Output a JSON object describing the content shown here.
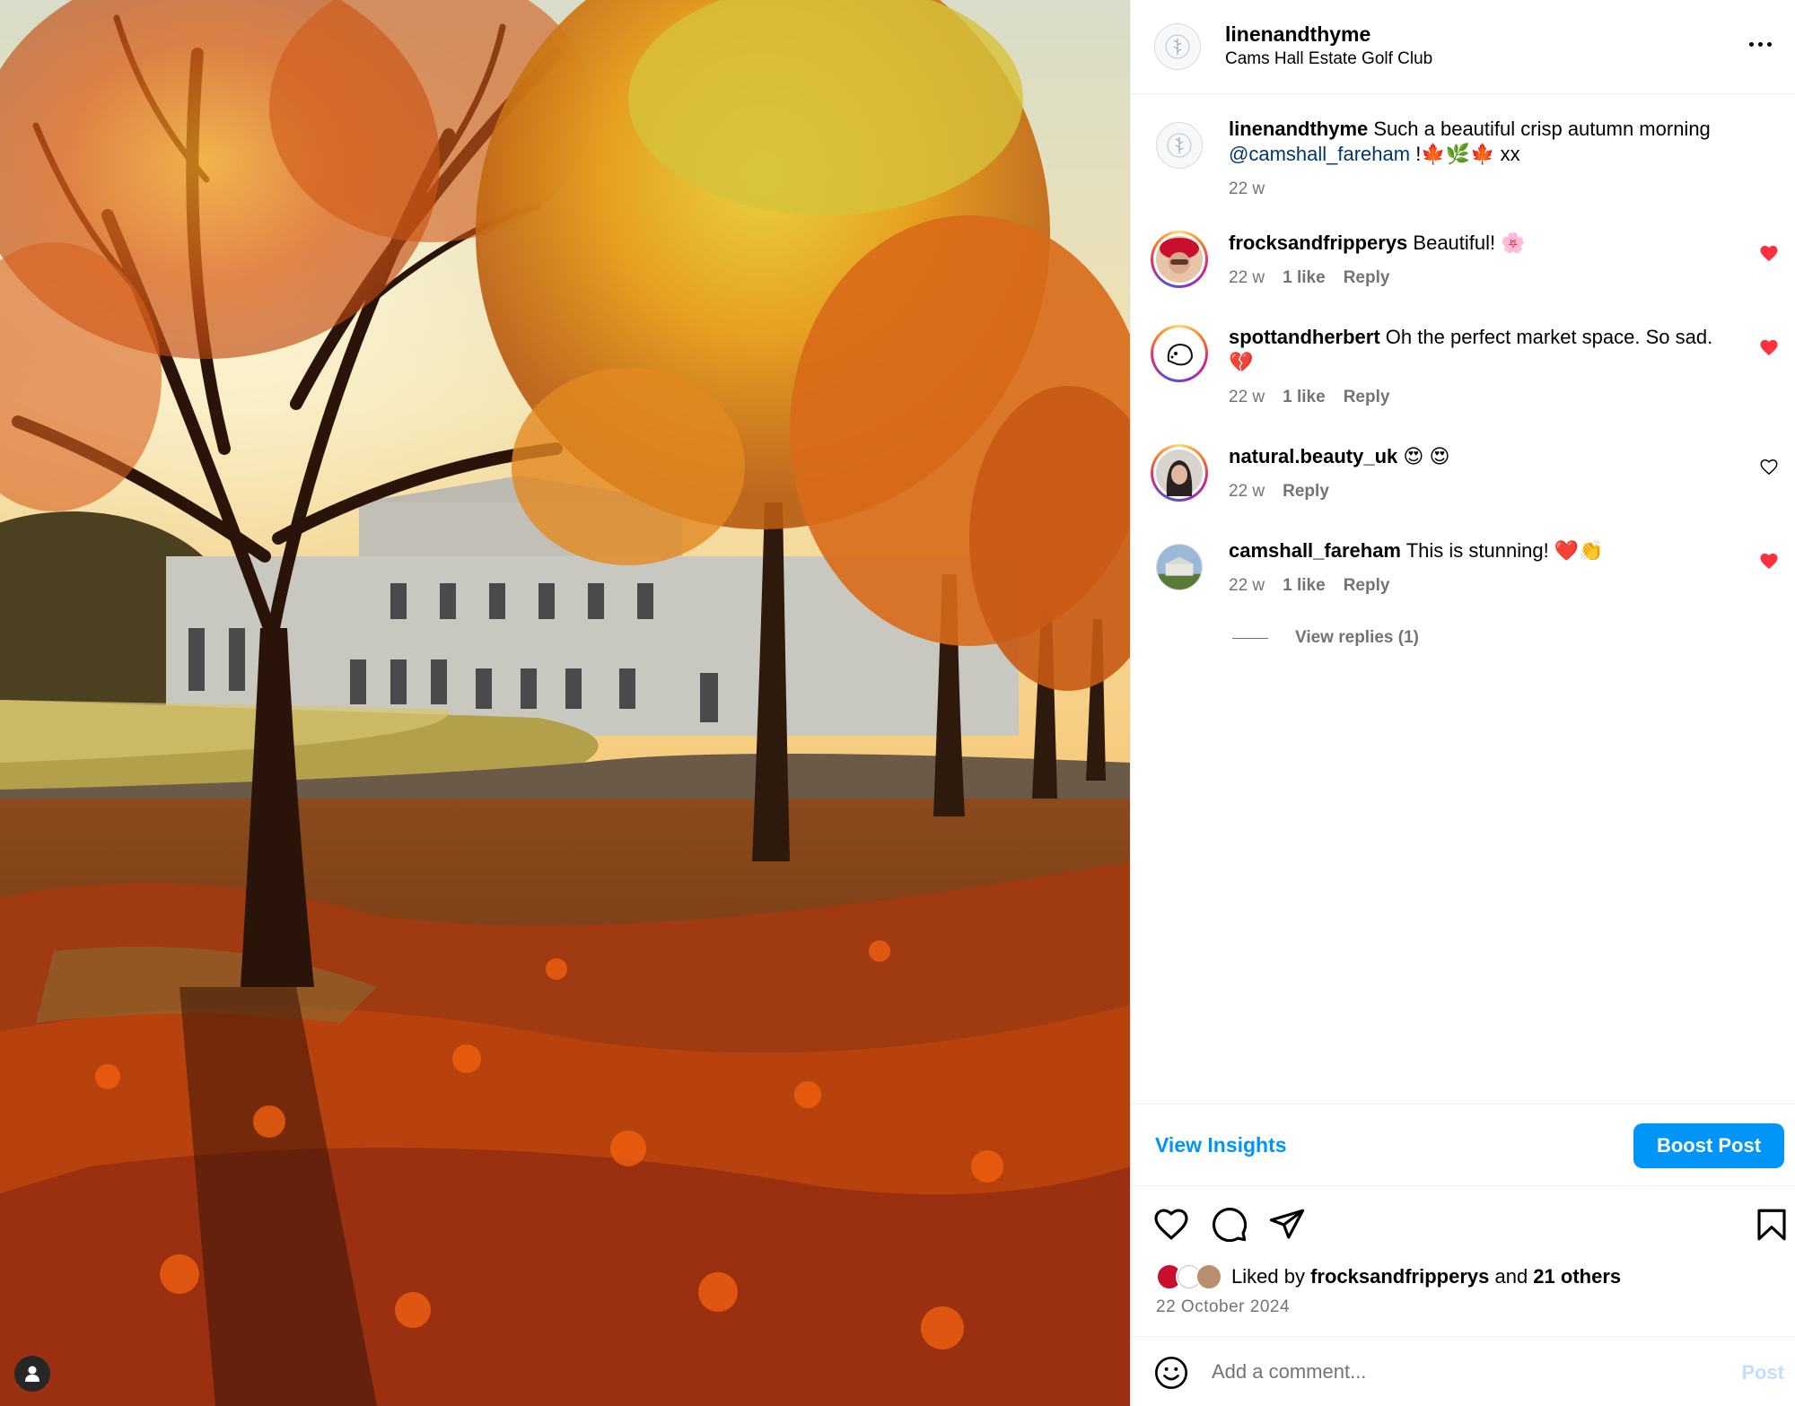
{
  "post": {
    "username": "linenandthyme",
    "location": "Cams Hall Estate Golf Club"
  },
  "caption": {
    "username": "linenandthyme",
    "text": " Such a beautiful crisp autumn morning ",
    "mention": "@camshall_fareham",
    "suffix": " !🍁🌿🍁 xx",
    "time": "22 w"
  },
  "comments": [
    {
      "username": "frocksandfripperys",
      "text": " Beautiful! 🌸",
      "time": "22 w",
      "likes": "1 like",
      "reply": "Reply",
      "liked": true
    },
    {
      "username": "spottandherbert",
      "text": " Oh the perfect market space. So sad. 💔",
      "time": "22 w",
      "likes": "1 like",
      "reply": "Reply",
      "liked": true
    },
    {
      "username": "natural.beauty_uk",
      "text": " 😍 😍",
      "time": "22 w",
      "likes": "",
      "reply": "Reply",
      "liked": false
    },
    {
      "username": "camshall_fareham",
      "text": " This is stunning! ❤️👏",
      "time": "22 w",
      "likes": "1 like",
      "reply": "Reply",
      "liked": true
    }
  ],
  "view_replies": "View replies (1)",
  "insights": {
    "view_label": "View Insights",
    "boost_label": "Boost Post"
  },
  "likes": {
    "prefix": "Liked by ",
    "first_user": "frocksandfripperys",
    "middle": " and ",
    "others": "21 others"
  },
  "date": "22 October 2024",
  "comment_box": {
    "placeholder": "Add a comment...",
    "post_label": "Post"
  },
  "icons": [
    "heart-icon",
    "comment-icon",
    "share-icon",
    "bookmark-icon",
    "emoji-icon",
    "more-icon",
    "user-tag-icon"
  ],
  "colors": {
    "accent": "#0095f6",
    "like_red": "#ff3040",
    "muted": "#737373"
  }
}
